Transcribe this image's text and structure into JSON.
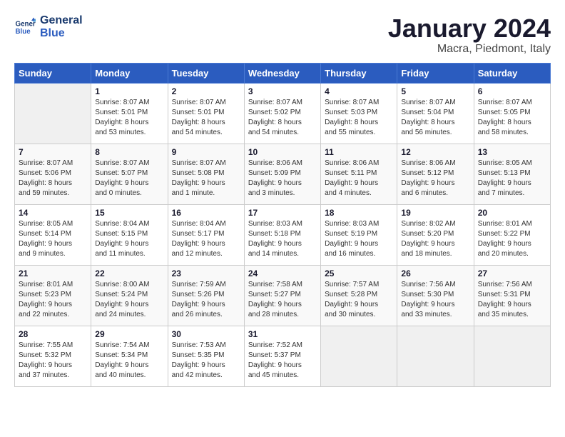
{
  "header": {
    "logo_line1": "General",
    "logo_line2": "Blue",
    "month": "January 2024",
    "location": "Macra, Piedmont, Italy"
  },
  "weekdays": [
    "Sunday",
    "Monday",
    "Tuesday",
    "Wednesday",
    "Thursday",
    "Friday",
    "Saturday"
  ],
  "weeks": [
    [
      {
        "day": "",
        "sunrise": "",
        "sunset": "",
        "daylight": ""
      },
      {
        "day": "1",
        "sunrise": "Sunrise: 8:07 AM",
        "sunset": "Sunset: 5:01 PM",
        "daylight": "Daylight: 8 hours and 53 minutes."
      },
      {
        "day": "2",
        "sunrise": "Sunrise: 8:07 AM",
        "sunset": "Sunset: 5:01 PM",
        "daylight": "Daylight: 8 hours and 54 minutes."
      },
      {
        "day": "3",
        "sunrise": "Sunrise: 8:07 AM",
        "sunset": "Sunset: 5:02 PM",
        "daylight": "Daylight: 8 hours and 54 minutes."
      },
      {
        "day": "4",
        "sunrise": "Sunrise: 8:07 AM",
        "sunset": "Sunset: 5:03 PM",
        "daylight": "Daylight: 8 hours and 55 minutes."
      },
      {
        "day": "5",
        "sunrise": "Sunrise: 8:07 AM",
        "sunset": "Sunset: 5:04 PM",
        "daylight": "Daylight: 8 hours and 56 minutes."
      },
      {
        "day": "6",
        "sunrise": "Sunrise: 8:07 AM",
        "sunset": "Sunset: 5:05 PM",
        "daylight": "Daylight: 8 hours and 58 minutes."
      }
    ],
    [
      {
        "day": "7",
        "sunrise": "Sunrise: 8:07 AM",
        "sunset": "Sunset: 5:06 PM",
        "daylight": "Daylight: 8 hours and 59 minutes."
      },
      {
        "day": "8",
        "sunrise": "Sunrise: 8:07 AM",
        "sunset": "Sunset: 5:07 PM",
        "daylight": "Daylight: 9 hours and 0 minutes."
      },
      {
        "day": "9",
        "sunrise": "Sunrise: 8:07 AM",
        "sunset": "Sunset: 5:08 PM",
        "daylight": "Daylight: 9 hours and 1 minute."
      },
      {
        "day": "10",
        "sunrise": "Sunrise: 8:06 AM",
        "sunset": "Sunset: 5:09 PM",
        "daylight": "Daylight: 9 hours and 3 minutes."
      },
      {
        "day": "11",
        "sunrise": "Sunrise: 8:06 AM",
        "sunset": "Sunset: 5:11 PM",
        "daylight": "Daylight: 9 hours and 4 minutes."
      },
      {
        "day": "12",
        "sunrise": "Sunrise: 8:06 AM",
        "sunset": "Sunset: 5:12 PM",
        "daylight": "Daylight: 9 hours and 6 minutes."
      },
      {
        "day": "13",
        "sunrise": "Sunrise: 8:05 AM",
        "sunset": "Sunset: 5:13 PM",
        "daylight": "Daylight: 9 hours and 7 minutes."
      }
    ],
    [
      {
        "day": "14",
        "sunrise": "Sunrise: 8:05 AM",
        "sunset": "Sunset: 5:14 PM",
        "daylight": "Daylight: 9 hours and 9 minutes."
      },
      {
        "day": "15",
        "sunrise": "Sunrise: 8:04 AM",
        "sunset": "Sunset: 5:15 PM",
        "daylight": "Daylight: 9 hours and 11 minutes."
      },
      {
        "day": "16",
        "sunrise": "Sunrise: 8:04 AM",
        "sunset": "Sunset: 5:17 PM",
        "daylight": "Daylight: 9 hours and 12 minutes."
      },
      {
        "day": "17",
        "sunrise": "Sunrise: 8:03 AM",
        "sunset": "Sunset: 5:18 PM",
        "daylight": "Daylight: 9 hours and 14 minutes."
      },
      {
        "day": "18",
        "sunrise": "Sunrise: 8:03 AM",
        "sunset": "Sunset: 5:19 PM",
        "daylight": "Daylight: 9 hours and 16 minutes."
      },
      {
        "day": "19",
        "sunrise": "Sunrise: 8:02 AM",
        "sunset": "Sunset: 5:20 PM",
        "daylight": "Daylight: 9 hours and 18 minutes."
      },
      {
        "day": "20",
        "sunrise": "Sunrise: 8:01 AM",
        "sunset": "Sunset: 5:22 PM",
        "daylight": "Daylight: 9 hours and 20 minutes."
      }
    ],
    [
      {
        "day": "21",
        "sunrise": "Sunrise: 8:01 AM",
        "sunset": "Sunset: 5:23 PM",
        "daylight": "Daylight: 9 hours and 22 minutes."
      },
      {
        "day": "22",
        "sunrise": "Sunrise: 8:00 AM",
        "sunset": "Sunset: 5:24 PM",
        "daylight": "Daylight: 9 hours and 24 minutes."
      },
      {
        "day": "23",
        "sunrise": "Sunrise: 7:59 AM",
        "sunset": "Sunset: 5:26 PM",
        "daylight": "Daylight: 9 hours and 26 minutes."
      },
      {
        "day": "24",
        "sunrise": "Sunrise: 7:58 AM",
        "sunset": "Sunset: 5:27 PM",
        "daylight": "Daylight: 9 hours and 28 minutes."
      },
      {
        "day": "25",
        "sunrise": "Sunrise: 7:57 AM",
        "sunset": "Sunset: 5:28 PM",
        "daylight": "Daylight: 9 hours and 30 minutes."
      },
      {
        "day": "26",
        "sunrise": "Sunrise: 7:56 AM",
        "sunset": "Sunset: 5:30 PM",
        "daylight": "Daylight: 9 hours and 33 minutes."
      },
      {
        "day": "27",
        "sunrise": "Sunrise: 7:56 AM",
        "sunset": "Sunset: 5:31 PM",
        "daylight": "Daylight: 9 hours and 35 minutes."
      }
    ],
    [
      {
        "day": "28",
        "sunrise": "Sunrise: 7:55 AM",
        "sunset": "Sunset: 5:32 PM",
        "daylight": "Daylight: 9 hours and 37 minutes."
      },
      {
        "day": "29",
        "sunrise": "Sunrise: 7:54 AM",
        "sunset": "Sunset: 5:34 PM",
        "daylight": "Daylight: 9 hours and 40 minutes."
      },
      {
        "day": "30",
        "sunrise": "Sunrise: 7:53 AM",
        "sunset": "Sunset: 5:35 PM",
        "daylight": "Daylight: 9 hours and 42 minutes."
      },
      {
        "day": "31",
        "sunrise": "Sunrise: 7:52 AM",
        "sunset": "Sunset: 5:37 PM",
        "daylight": "Daylight: 9 hours and 45 minutes."
      },
      {
        "day": "",
        "sunrise": "",
        "sunset": "",
        "daylight": ""
      },
      {
        "day": "",
        "sunrise": "",
        "sunset": "",
        "daylight": ""
      },
      {
        "day": "",
        "sunrise": "",
        "sunset": "",
        "daylight": ""
      }
    ]
  ]
}
